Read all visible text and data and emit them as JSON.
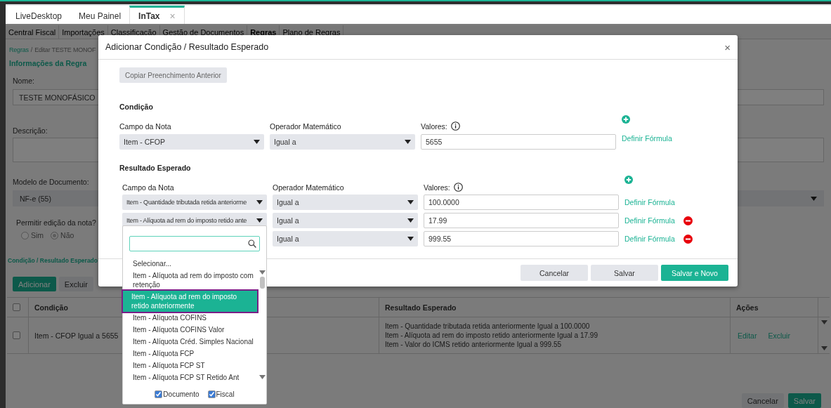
{
  "tabs": [
    {
      "label": "LiveDesktop",
      "selected": false
    },
    {
      "label": "Meu Painel",
      "selected": false
    },
    {
      "label": "InTax",
      "selected": true,
      "close": "×"
    }
  ],
  "nav": [
    {
      "label": "Central Fiscal",
      "selected": false
    },
    {
      "label": "Importações",
      "selected": false
    },
    {
      "label": "Classificação",
      "selected": false
    },
    {
      "label": "Gestão de Documentos",
      "selected": false
    },
    {
      "label": "Regras",
      "selected": true
    },
    {
      "label": "Plano de Regras",
      "selected": false
    }
  ],
  "breadcrumb": {
    "link": "Regras",
    "separator": "/",
    "current": "Editar TESTE MONOF"
  },
  "form": {
    "section": "Informações da Regra",
    "name_label": "Nome:",
    "name_value": "TESTE MONOFÁSICO",
    "description_label": "Descrição:",
    "model_label": "Modelo de Documento:",
    "model_value": "NF-e (55)",
    "edit_label": "Permitir edição da nota?",
    "edit_options": [
      {
        "label": "Sim",
        "selected": false
      },
      {
        "label": "Não",
        "selected": true
      }
    ]
  },
  "rules": {
    "section": "Condição / Resultado Esperado",
    "buttons": [
      {
        "label": "Adicionar",
        "kind": "primary"
      },
      {
        "label": "Excluir",
        "kind": "secondary"
      }
    ],
    "header_checked": false,
    "columns": [
      "Condição",
      "Resultado Esperado",
      "Ações"
    ],
    "rows": [
      {
        "checked": false,
        "condition": "Item - CFOP Igual a 5655",
        "results": [
          "Item - Quantidade tributada retida anteriormente Igual a 100.0000",
          "Item - Alíquota ad rem do imposto retido anteriormente Igual a 17.99",
          "Item - Valor do ICMS retido anteriormente Igual a 999.55"
        ],
        "actions": [
          "Editar",
          "Excluir"
        ]
      }
    ]
  },
  "page_buttons": [
    {
      "label": "Cancelar",
      "kind": "secondary"
    },
    {
      "label": "Salvar",
      "kind": "primary"
    }
  ],
  "modal": {
    "title": "Adicionar Condição / Resultado Esperado",
    "close": "×",
    "copy_button": "Copiar Preenchimento Anterior",
    "condition": {
      "title": "Condição",
      "field_label": "Campo da Nota",
      "operator_label": "Operador Matemático",
      "values_label": "Valores:",
      "field": "Item - CFOP",
      "operator": "Igual a",
      "value": "5655",
      "formula": "Definir Fórmula"
    },
    "result": {
      "title": "Resultado Esperado",
      "field_label": "Campo da Nota",
      "operator_label": "Operador Matemático",
      "values_label": "Valores:",
      "rows": [
        {
          "field": "Item - Quantidade tributada retida anteriorme",
          "operator": "Igual a",
          "value": "100.0000",
          "formula": "Definir Fórmula",
          "removable": false
        },
        {
          "field": "Item - Alíquota ad rem do imposto retido ante",
          "operator": "Igual a",
          "value": "17.99",
          "formula": "Definir Fórmula",
          "removable": true
        },
        {
          "operator": "Igual a",
          "value": "999.55",
          "formula": "Definir Fórmula",
          "removable": true
        }
      ]
    },
    "buttons": [
      {
        "label": "Cancelar",
        "kind": "secondary"
      },
      {
        "label": "Salvar",
        "kind": "secondary"
      },
      {
        "label": "Salvar e Novo",
        "kind": "primary"
      }
    ]
  },
  "dropdown": {
    "options": [
      {
        "label": "Selecionar...",
        "selected": false
      },
      {
        "label": "Item - Alíquota ad rem do imposto com retenção",
        "selected": false
      },
      {
        "label": "Item - Alíquota ad rem do imposto retido anteriormente",
        "selected": true
      },
      {
        "label": "Item - Alíquota COFINS",
        "selected": false
      },
      {
        "label": "Item - Alíquota COFINS Valor",
        "selected": false
      },
      {
        "label": "Item - Alíquota Créd. Simples Nacional",
        "selected": false
      },
      {
        "label": "Item - Alíquota FCP",
        "selected": false
      },
      {
        "label": "Item - Alíquota FCP ST",
        "selected": false
      },
      {
        "label": "Item - Alíquota FCP ST Retido Ant",
        "selected": false
      }
    ],
    "filters": [
      {
        "label": "Documento",
        "checked": true
      },
      {
        "label": "Fiscal",
        "checked": true
      }
    ]
  }
}
